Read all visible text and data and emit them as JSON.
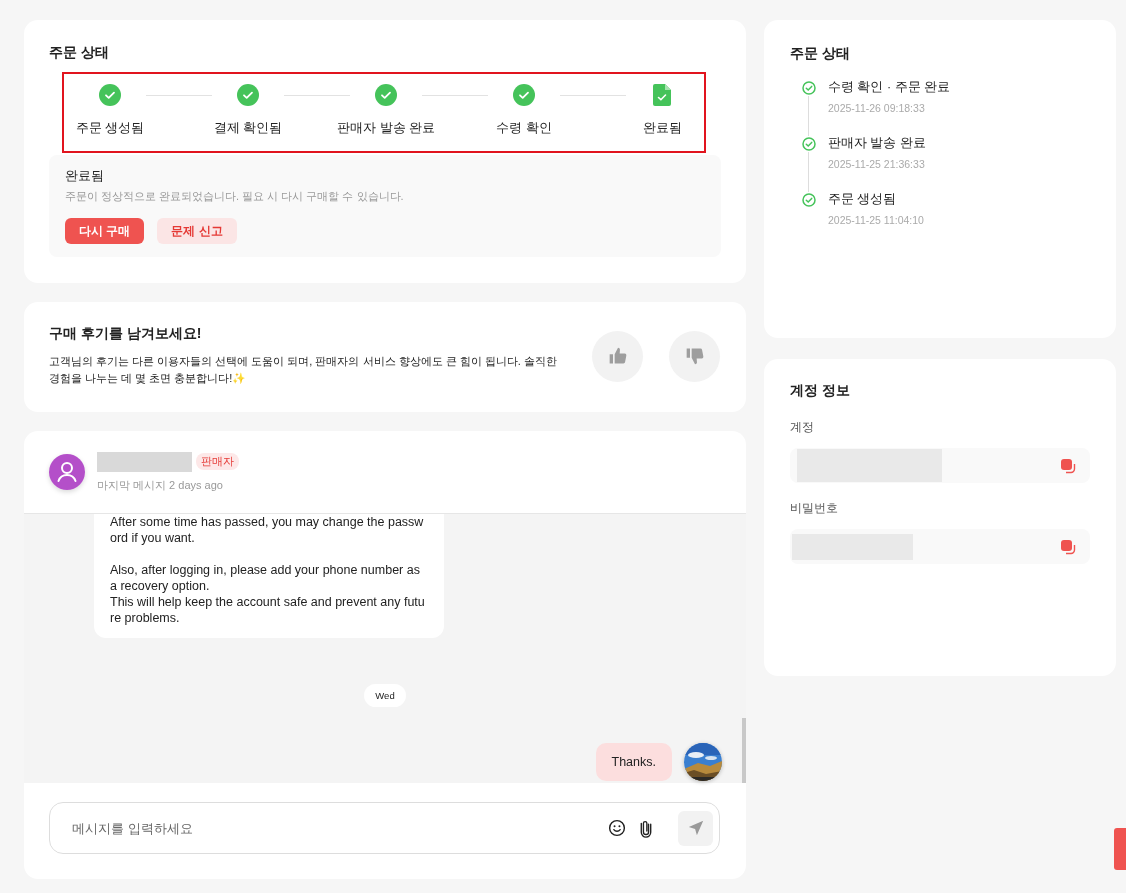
{
  "order_status": {
    "title": "주문 상태",
    "steps": [
      {
        "label": "주문 생성됨",
        "kind": "done"
      },
      {
        "label": "결제 확인됨",
        "kind": "done"
      },
      {
        "label": "판매자 발송 완료",
        "kind": "done"
      },
      {
        "label": "수령 확인",
        "kind": "done"
      },
      {
        "label": "완료됨",
        "kind": "document"
      }
    ],
    "detail": {
      "title": "완료됨",
      "description": "주문이 정상적으로 완료되었습니다. 필요 시 다시 구매할 수 있습니다.",
      "buttons": [
        {
          "label": "다시 구매",
          "kind": "primary"
        },
        {
          "label": "문제 신고",
          "kind": "secondary"
        }
      ]
    }
  },
  "review": {
    "title": "구매 후기를 남겨보세요!",
    "text": "고객님의 후기는 다른 이용자들의 선택에 도움이 되며, 판매자의 서비스 향상에도 큰 힘이 됩니다. 솔직한 경험을 나누는 데 몇 초면 충분합니다!✨"
  },
  "chat": {
    "seller": {
      "badge": "판매자",
      "subtitle": "마지막 메시지 2 days ago"
    },
    "messages": [
      {
        "kind": "incoming",
        "text": "After some time has passed, you may change the password if you want.\n\nAlso, after logging in, please add your phone number as a recovery option.\nThis will help keep the account safe and prevent any future problems."
      },
      {
        "kind": "date",
        "text": "Wed"
      },
      {
        "kind": "outgoing",
        "text": "Thanks."
      }
    ],
    "input": {
      "placeholder": "메시지를 입력하세요"
    }
  },
  "history": {
    "title": "주문 상태",
    "events": [
      {
        "title": "수령 확인 · 주문 완료",
        "time": "2025-11-26 09:18:33"
      },
      {
        "title": "판매자 발송 완료",
        "time": "2025-11-25 21:36:33"
      },
      {
        "title": "주문 생성됨",
        "time": "2025-11-25 11:04:10"
      }
    ]
  },
  "account": {
    "title": "계정 정보",
    "fields": [
      {
        "label": "계정"
      },
      {
        "label": "비밀번호"
      }
    ]
  }
}
